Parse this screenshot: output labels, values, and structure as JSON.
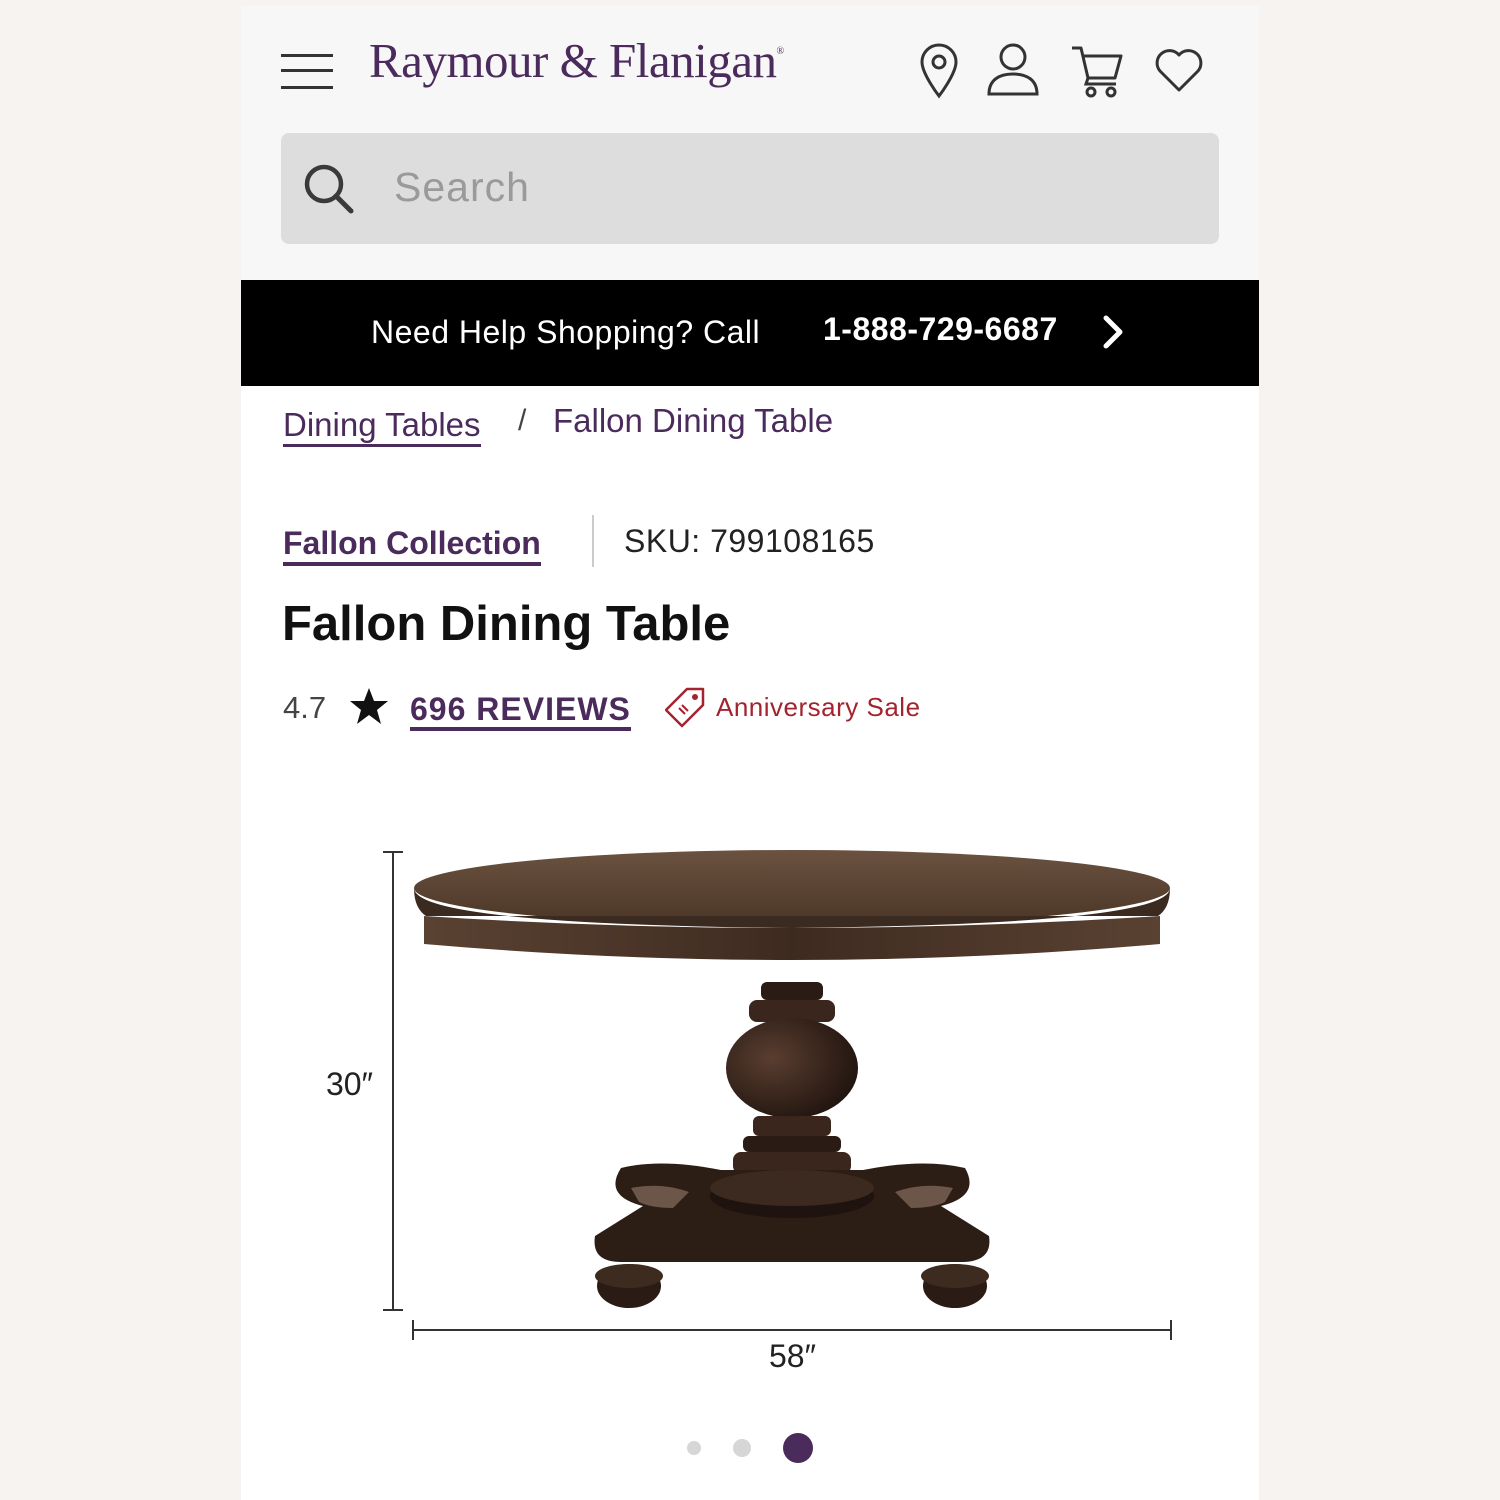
{
  "header": {
    "logo_text": "Raymour & Flanigan",
    "logo_mark": "®",
    "icons": [
      "menu-icon",
      "location-pin-icon",
      "account-icon",
      "cart-icon",
      "heart-icon"
    ]
  },
  "search": {
    "placeholder": "Search",
    "icon": "search-icon"
  },
  "help_bar": {
    "text": "Need Help Shopping? Call",
    "phone": "1-888-729-6687",
    "icon": "chevron-right-icon"
  },
  "breadcrumb": {
    "parent": "Dining Tables",
    "separator": "/",
    "current": "Fallon Dining Table"
  },
  "product": {
    "collection": "Fallon Collection",
    "sku": "SKU: 799108165",
    "title": "Fallon Dining Table",
    "rating": "4.7",
    "reviews": "696 REVIEWS",
    "promo": "Anniversary Sale",
    "dimension_height": "30″",
    "dimension_width": "58″"
  },
  "carousel": {
    "count": 3,
    "active_index": 2
  },
  "colors": {
    "brand_purple": "#4b2a5c",
    "promo_red": "#a3232f",
    "help_bar_bg": "#000000"
  }
}
